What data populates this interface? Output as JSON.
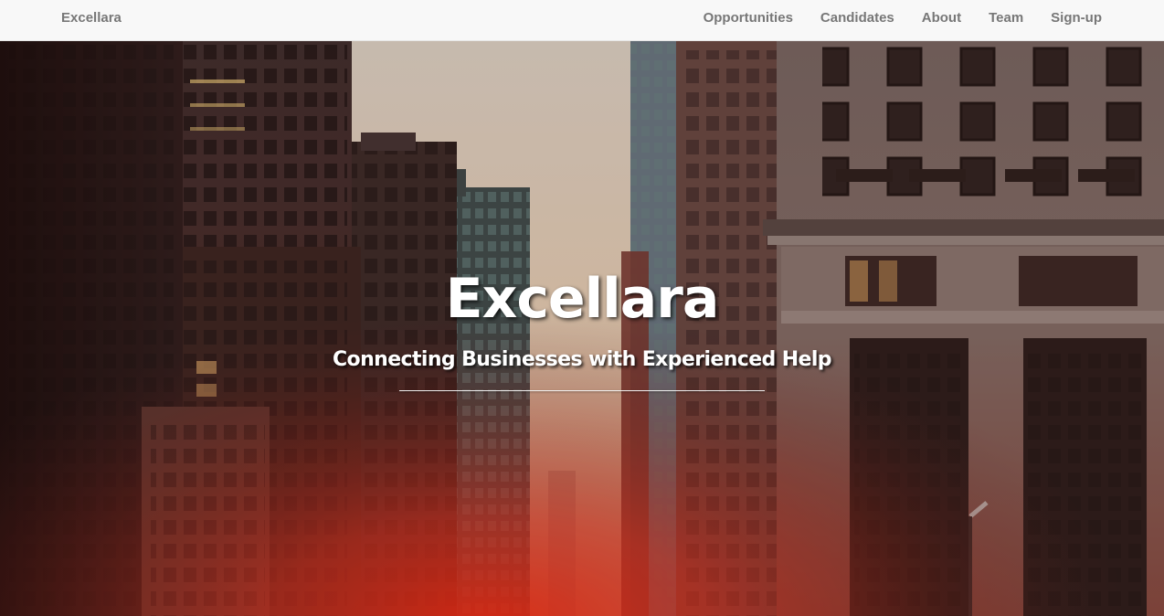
{
  "navbar": {
    "brand": "Excellara",
    "links": [
      {
        "label": "Opportunities"
      },
      {
        "label": "Candidates"
      },
      {
        "label": "About"
      },
      {
        "label": "Team"
      },
      {
        "label": "Sign-up"
      }
    ]
  },
  "hero": {
    "title": "Excellara",
    "subtitle": "Connecting Businesses with Experienced Help",
    "background": "city-street-skyscrapers-photo"
  },
  "colors": {
    "navbar_bg": "#f8f8f8",
    "nav_text": "#777777",
    "hero_text": "#ffffff",
    "hero_glow": "#e0301e"
  }
}
